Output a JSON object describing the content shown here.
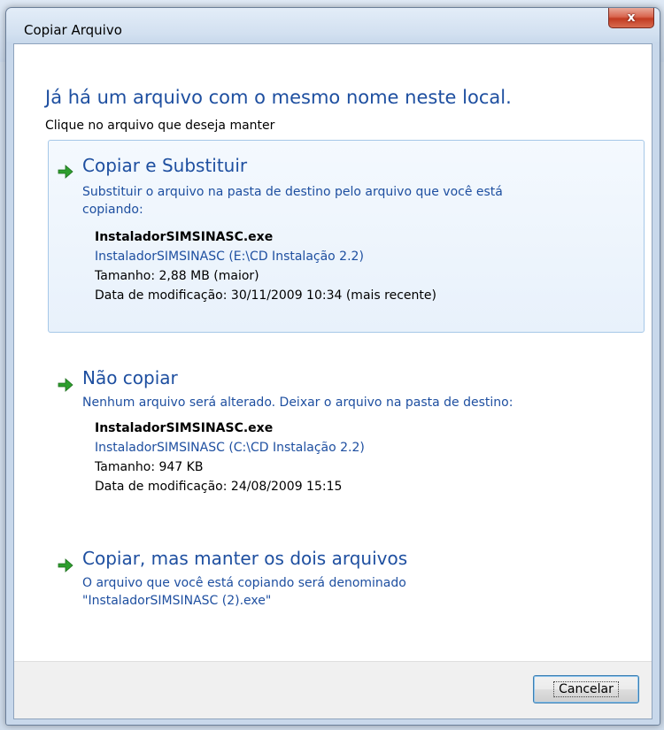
{
  "window": {
    "title": "Copiar Arquivo",
    "close_label": "x"
  },
  "dialog": {
    "heading": "Já há um arquivo com o mesmo nome neste local.",
    "subheading": "Clique no arquivo que deseja manter"
  },
  "options": [
    {
      "icon": "green-arrow-icon",
      "title": "Copiar e Substituir",
      "desc_line1": "Substituir o arquivo na pasta de destino pelo arquivo que você está",
      "desc_line2": "copiando:",
      "file": {
        "name": "InstaladorSIMSINASC.exe",
        "path": "InstaladorSIMSINASC (E:\\CD Instalação 2.2)",
        "size": "Tamanho: 2,88 MB (maior)",
        "modified": "Data de modificação: 30/11/2009 10:34 (mais recente)"
      }
    },
    {
      "icon": "green-arrow-icon",
      "title": "Não copiar",
      "desc_line1": "Nenhum arquivo será alterado. Deixar o arquivo na pasta de destino:",
      "file": {
        "name": "InstaladorSIMSINASC.exe",
        "path": "InstaladorSIMSINASC (C:\\CD Instalação 2.2)",
        "size": "Tamanho: 947 KB",
        "modified": "Data de modificação: 24/08/2009 15:15"
      }
    },
    {
      "icon": "green-arrow-icon",
      "title": "Copiar, mas manter os dois arquivos",
      "desc_line1": "O arquivo que você está copiando será denominado",
      "desc_line2": "\"InstaladorSIMSINASC (2).exe\""
    }
  ],
  "footer": {
    "cancel_label": "Cancelar"
  },
  "colors": {
    "heading_blue": "#1e4fa0",
    "arrow_green": "#2e9e2e",
    "highlight_border": "#a6c8e8"
  }
}
